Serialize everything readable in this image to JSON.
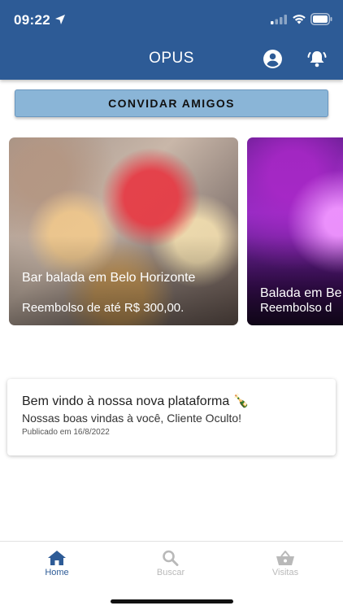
{
  "status_bar": {
    "time": "09:22"
  },
  "header": {
    "title": "OPUS",
    "background_color": "#2d5b96"
  },
  "invite_button": {
    "label": "CONVIDAR AMIGOS",
    "color": "#8ab5d7"
  },
  "carousel": {
    "cards": [
      {
        "title": "Bar balada em Belo Horizonte",
        "subtitle": "Reembolso de até R$ 300,00."
      },
      {
        "title": "Balada em Be",
        "subtitle": "Reembolso d"
      }
    ]
  },
  "news": {
    "title": "Bem vindo à nossa nova plataforma 🍾",
    "body": "Nossas boas vindas à você, Cliente Oculto!",
    "date": "Publicado em 16/8/2022"
  },
  "tabs": [
    {
      "label": "Home",
      "icon": "home-icon",
      "active": true
    },
    {
      "label": "Buscar",
      "icon": "search-icon",
      "active": false
    },
    {
      "label": "Visitas",
      "icon": "basket-icon",
      "active": false
    }
  ],
  "colors": {
    "active_tab": "#2d5b96",
    "inactive_tab": "#b9b9b9"
  }
}
